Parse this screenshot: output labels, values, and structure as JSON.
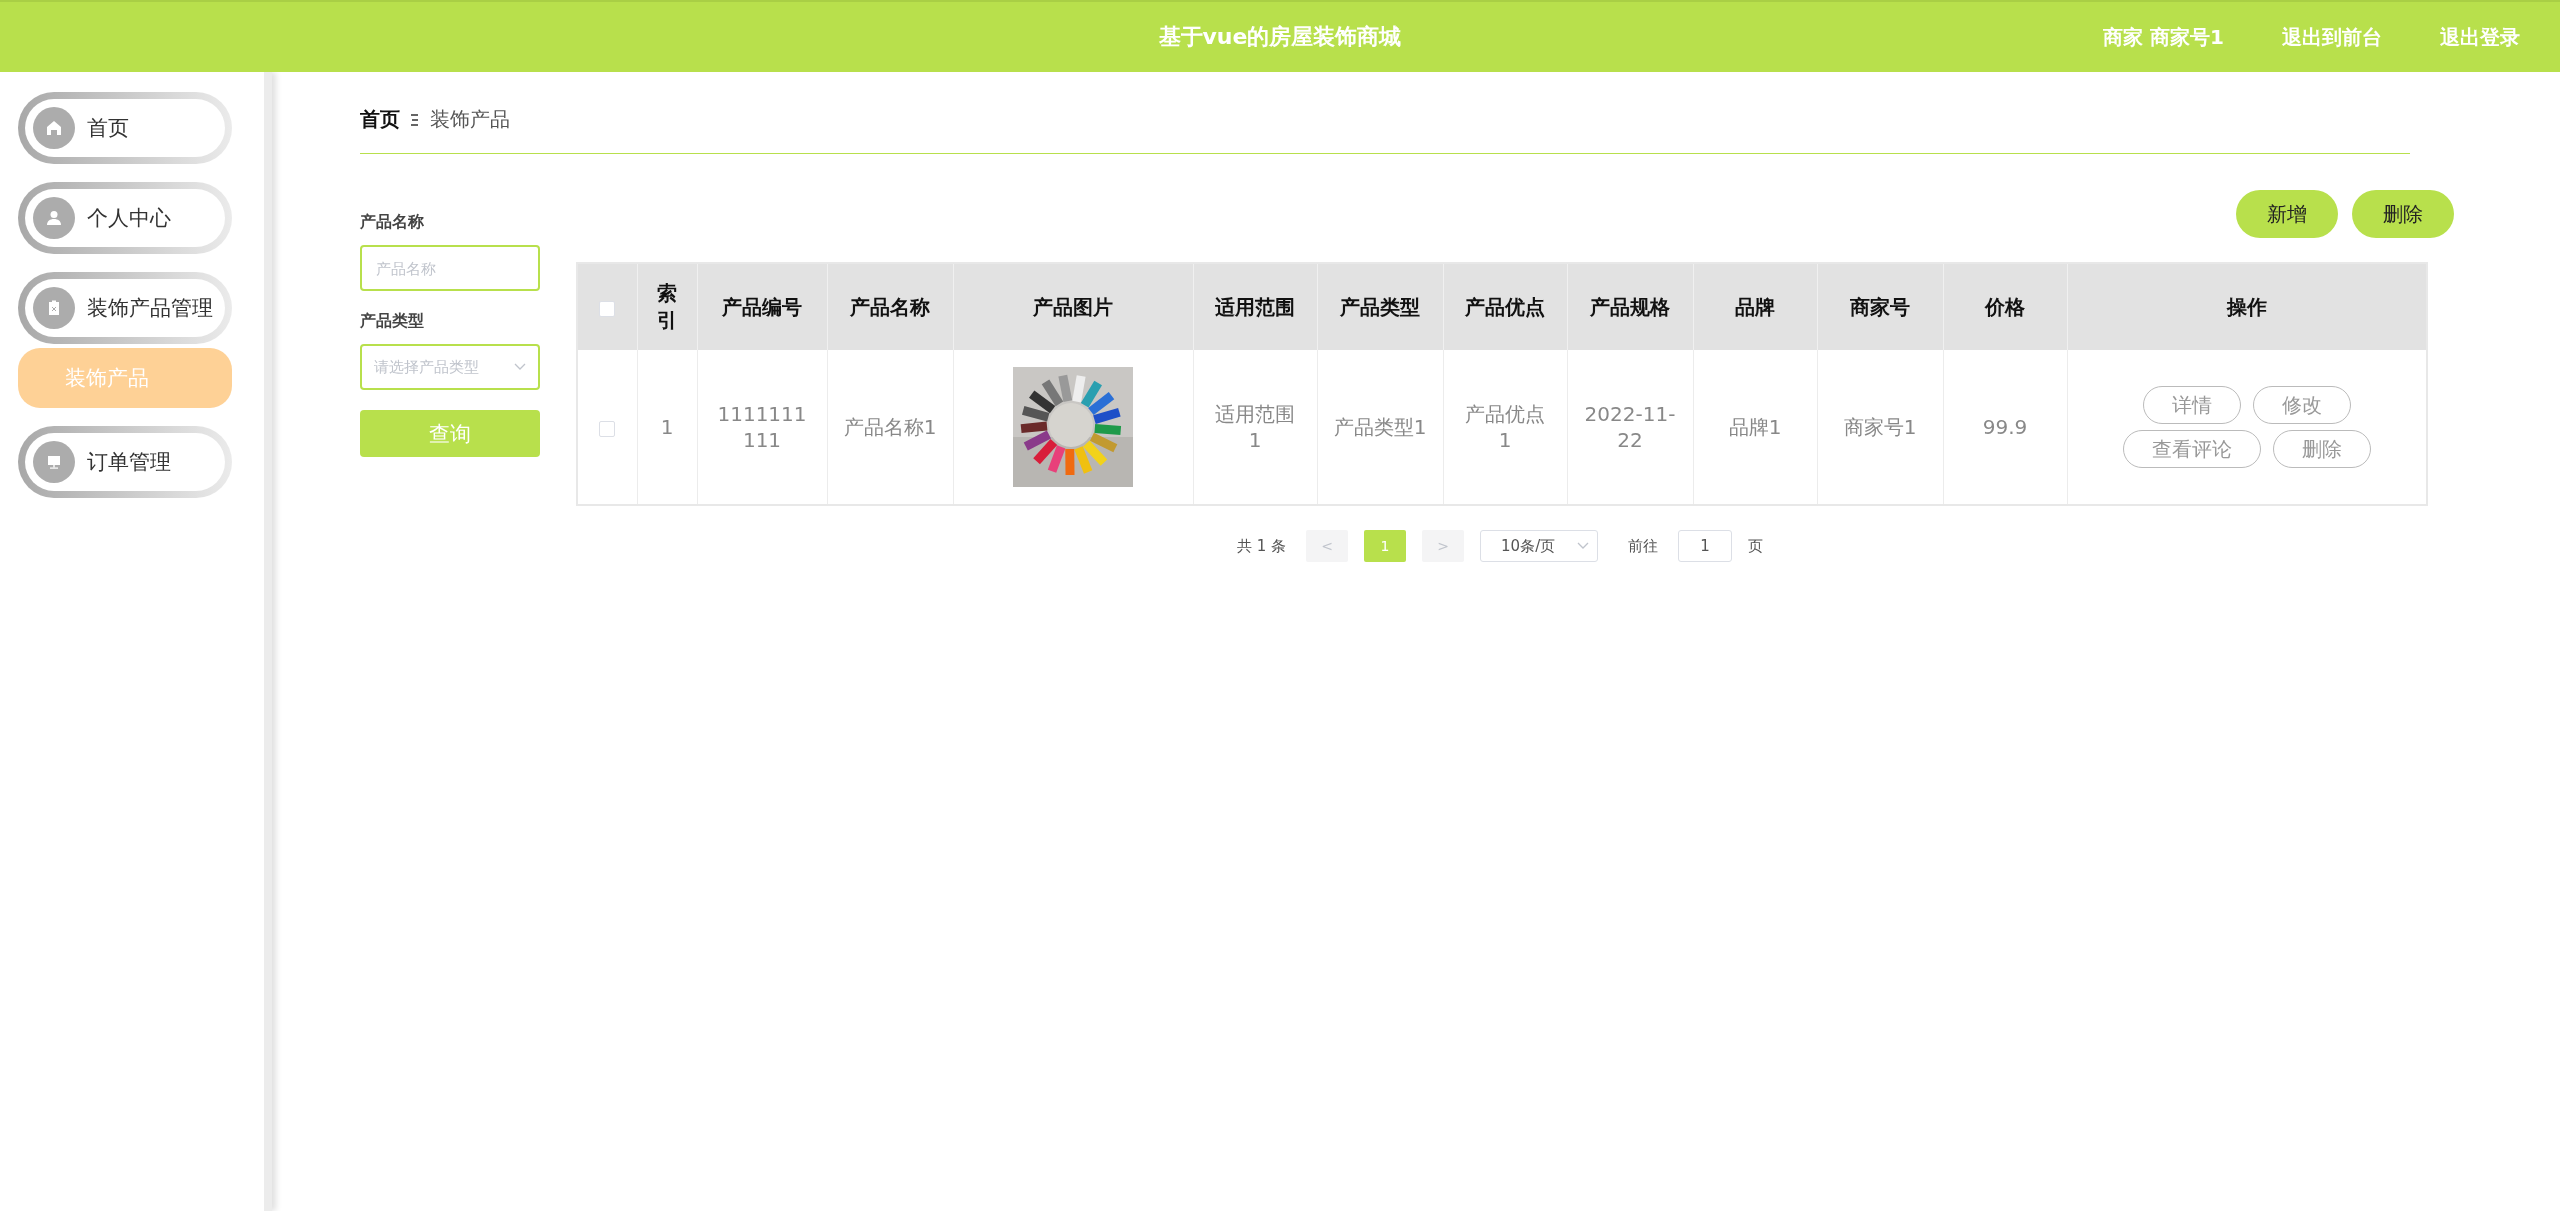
{
  "header": {
    "title": "基于vue的房屋装饰商城",
    "user_label": "商家 商家号1",
    "links": [
      "退出到前台",
      "退出登录"
    ]
  },
  "sidebar": {
    "items": [
      {
        "label": "首页",
        "selected": false
      },
      {
        "label": "个人中心",
        "selected": false
      },
      {
        "label": "装饰产品管理",
        "selected": false,
        "children": [
          {
            "label": "装饰产品",
            "selected": true
          }
        ]
      },
      {
        "label": "订单管理",
        "selected": false
      }
    ]
  },
  "breadcrumb": [
    "首页",
    "装饰产品"
  ],
  "filters": [
    {
      "kind": "input",
      "label": "产品名称",
      "placeholder": "产品名称"
    },
    {
      "kind": "select",
      "label": "产品类型",
      "placeholder": "请选择产品类型"
    }
  ],
  "search_button": "查询",
  "toolbar_buttons": [
    "新增",
    "删除"
  ],
  "table": {
    "select_all_checked": false,
    "columns": [
      "索引",
      "产品编号",
      "产品名称",
      "产品图片",
      "适用范围",
      "产品类型",
      "产品优点",
      "产品规格",
      "品牌",
      "商家号",
      "价格",
      "操作"
    ],
    "rows": [
      {
        "checked": false,
        "cells": [
          "1",
          "1111111111",
          "产品名称1",
          {
            "kind": "picture"
          },
          "适用范围1",
          "产品类型1",
          "产品优点1",
          "2022-11-22",
          "品牌1",
          "商家号1",
          "99.9"
        ],
        "actions": [
          "详情",
          "修改",
          "查看评论",
          "删除"
        ]
      }
    ]
  },
  "pagination": {
    "total": "共 1 条",
    "prev": "<",
    "pages": [
      {
        "label": "1",
        "selected": true
      }
    ],
    "next": ">",
    "page_size": "10条/页",
    "goto_label": "前往",
    "goto_value": "1",
    "goto_suffix": "页"
  }
}
